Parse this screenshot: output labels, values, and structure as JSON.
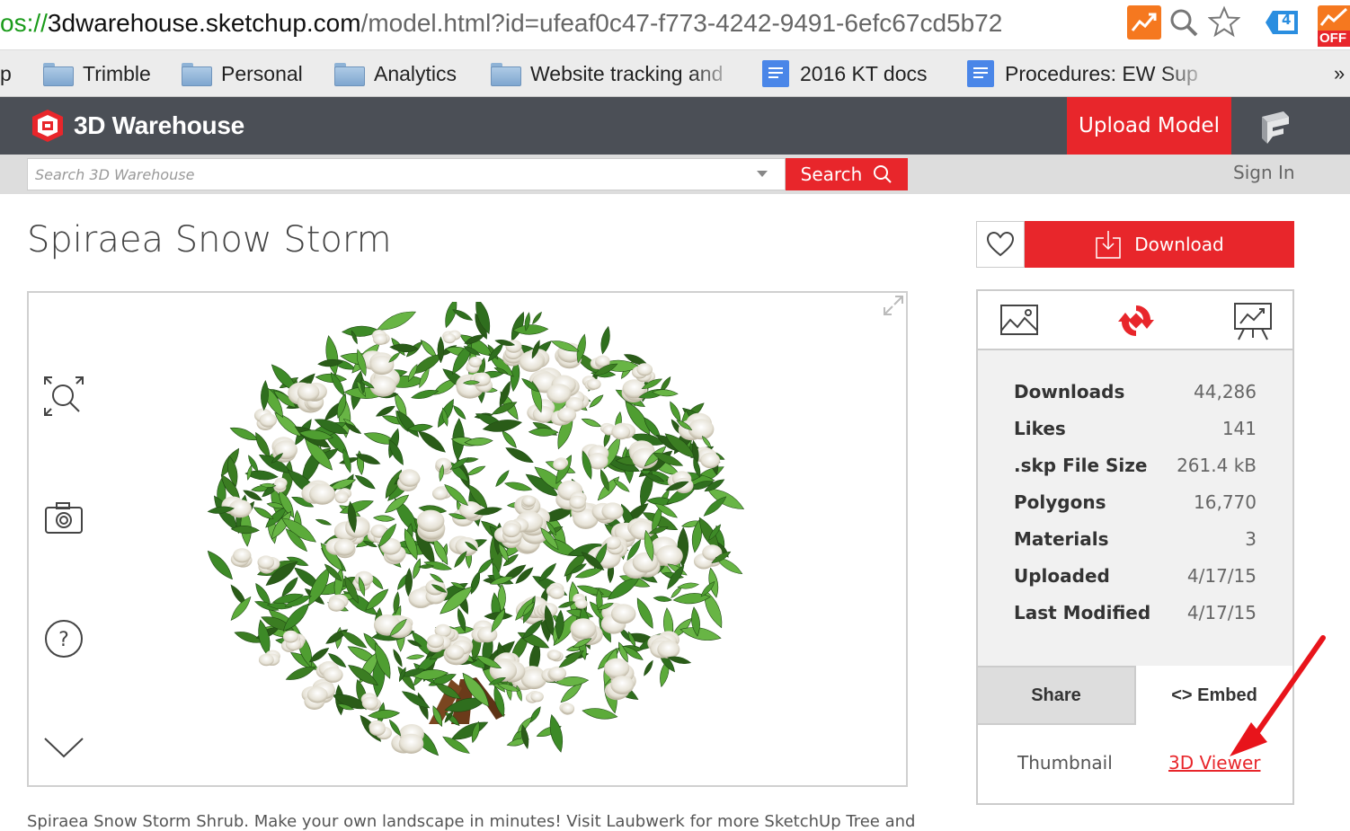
{
  "browser": {
    "url": {
      "scheme": "os://",
      "host": "3dwarehouse.sketchup.com",
      "path": "/model.html?id=ufeaf0c47-f773-4242-9491-6efc67cd5b72"
    },
    "extension_badge": "4",
    "extension_off_label": "OFF",
    "bookmarks": [
      {
        "label": "p",
        "type": "text"
      },
      {
        "label": "Trimble",
        "type": "folder"
      },
      {
        "label": "Personal",
        "type": "folder"
      },
      {
        "label": "Analytics",
        "type": "folder"
      },
      {
        "label": "Website tracking and",
        "type": "folder"
      },
      {
        "label": "2016 KT docs",
        "type": "doc"
      },
      {
        "label": "Procedures: EW Sup",
        "type": "doc"
      }
    ],
    "overflow_label": "»"
  },
  "site": {
    "logo_text": "3D Warehouse",
    "upload_label": "Upload Model",
    "search_placeholder": "Search 3D Warehouse",
    "search_button": "Search",
    "signin_label": "Sign In"
  },
  "model": {
    "title": "Spiraea Snow Storm",
    "download_label": "Download",
    "stats": [
      {
        "label": "Downloads",
        "value": "44,286"
      },
      {
        "label": "Likes",
        "value": "141"
      },
      {
        "label": ".skp File Size",
        "value": "261.4 kB"
      },
      {
        "label": "Polygons",
        "value": "16,770"
      },
      {
        "label": "Materials",
        "value": "3"
      },
      {
        "label": "Uploaded",
        "value": "4/17/15"
      },
      {
        "label": "Last Modified",
        "value": "4/17/15"
      }
    ],
    "share_label": "Share",
    "embed_label": "<> Embed",
    "thumbnail_label": "Thumbnail",
    "viewer_link_label": "3D Viewer",
    "description": "Spiraea Snow Storm Shrub. Make your own landscape in minutes! Visit Laubwerk for more SketchUp Tree and"
  },
  "colors": {
    "accent": "#e8262b",
    "header_bg": "#4b4f56",
    "url_scheme": "#1a9b1a"
  }
}
